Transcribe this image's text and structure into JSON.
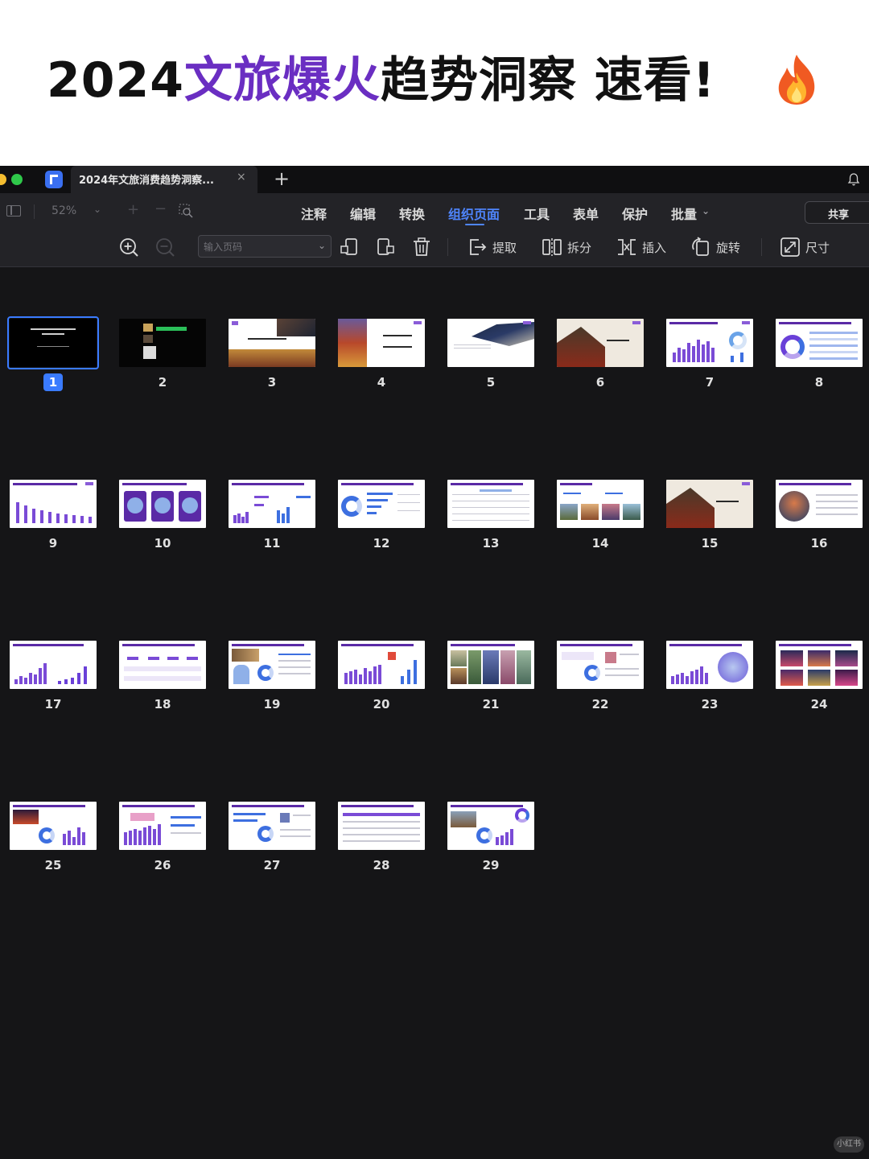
{
  "banner": {
    "title_part1": "2024",
    "title_accent": "文旅爆火",
    "title_part2": "趋势洞察 速看!",
    "emoji_icon": "fire-icon"
  },
  "window": {
    "tab_title": "2024年文旅消费趋势洞察...",
    "tab_close": "×",
    "new_tab": "+"
  },
  "menu": {
    "zoom": "52%",
    "items": [
      "注释",
      "编辑",
      "转换",
      "组织页面",
      "工具",
      "表单",
      "保护",
      "批量"
    ],
    "active": "组织页面",
    "share": "共享"
  },
  "tools": {
    "page_input_placeholder": "输入页码",
    "extract": "提取",
    "split": "拆分",
    "insert": "插入",
    "rotate": "旋转",
    "size": "尺寸"
  },
  "pages": {
    "selected": 1,
    "labels": [
      "1",
      "2",
      "3",
      "4",
      "5",
      "6",
      "7",
      "8",
      "9",
      "10",
      "11",
      "12",
      "13",
      "14",
      "15",
      "16",
      "17",
      "18",
      "19",
      "20",
      "21",
      "22",
      "23",
      "24",
      "25",
      "26",
      "27",
      "28",
      "29"
    ]
  },
  "watermark": "小红书",
  "colors": {
    "accent_purple": "#6a2ec2",
    "active_blue": "#4f86ff",
    "background": "#151517"
  }
}
